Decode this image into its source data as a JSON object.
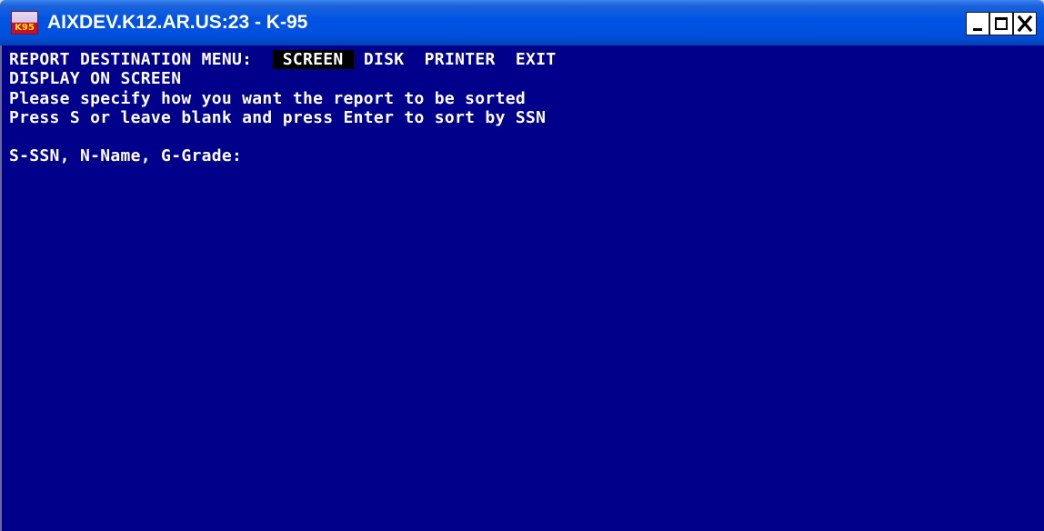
{
  "window": {
    "title": "AIXDEV.K12.AR.US:23 - K-95",
    "icon_label": "K95",
    "icon": "k95-app-icon",
    "controls": {
      "minimize": "minimize-icon",
      "maximize": "maximize-icon",
      "close": "close-icon"
    }
  },
  "terminal": {
    "background_color": "#00008b",
    "text_color": "#ffffff",
    "menu_label": "REPORT DESTINATION MENU:",
    "menu_items": [
      {
        "label": " SCREEN ",
        "selected": true
      },
      {
        "label": "DISK",
        "selected": false
      },
      {
        "label": "PRINTER",
        "selected": false
      },
      {
        "label": "EXIT",
        "selected": false
      }
    ],
    "line_2": "DISPLAY ON SCREEN",
    "line_3": "Please specify how you want the report to be sorted",
    "line_4": "Press S or leave blank and press Enter to sort by SSN",
    "prompt": "S-SSN, N-Name, G-Grade:"
  }
}
